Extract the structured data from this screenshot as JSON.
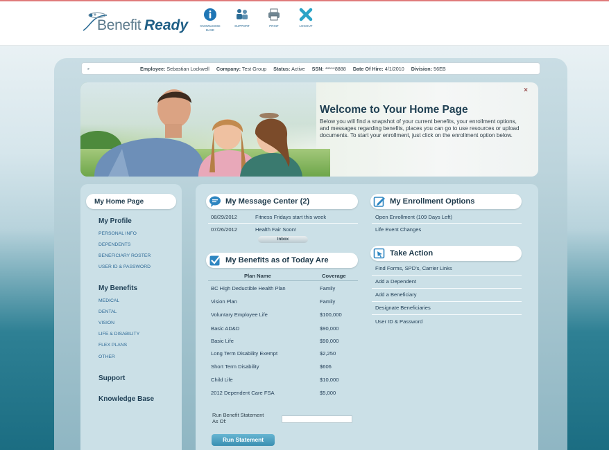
{
  "header": {
    "logo_text_1": "Benefit",
    "logo_text_2": "Ready",
    "nav": [
      {
        "label": "KNOWLEDGE BASE",
        "icon": "info-icon"
      },
      {
        "label": "SUPPORT",
        "icon": "people-icon"
      },
      {
        "label": "PRINT",
        "icon": "printer-icon"
      },
      {
        "label": "LOGOUT",
        "icon": "x-icon"
      }
    ]
  },
  "employee_bar": {
    "employee_label": "Employee:",
    "employee_value": "Sebastian Lockwell",
    "company_label": "Company:",
    "company_value": "Test Group",
    "status_label": "Status:",
    "status_value": "Active",
    "ssn_label": "SSN:",
    "ssn_value": "*****8888",
    "hire_label": "Date Of Hire:",
    "hire_value": "4/1/2010",
    "division_label": "Division:",
    "division_value": "56EB"
  },
  "welcome": {
    "close": "×",
    "title": "Welcome to Your Home Page",
    "body": "Below you will find a snapshot of your current benefits, your enrollment options, and messages regarding benefits, places you can go to use resources or upload documents. To start your enrollment, just click on the enrollment option below."
  },
  "sidebar": {
    "home": "My Home Page",
    "profile": {
      "title": "My Profile",
      "items": [
        "PERSONAL INFO",
        "DEPENDENTS",
        "BENEFICIARY ROSTER",
        "USER ID & PASSWORD"
      ]
    },
    "benefits": {
      "title": "My Benefits",
      "items": [
        "MEDICAL",
        "DENTAL",
        "VISION",
        "LIFE & DISABILITY",
        "FLEX PLANS",
        "OTHER"
      ]
    },
    "support": "Support",
    "knowledge": "Knowledge Base"
  },
  "message_center": {
    "title": "My Message Center (2)",
    "messages": [
      {
        "date": "08/29/2012",
        "subject": "Fitness Fridays start this week"
      },
      {
        "date": "07/26/2012",
        "subject": "Health Fair Soon!"
      }
    ],
    "inbox_label": "Inbox"
  },
  "benefits_today": {
    "title": "My Benefits as of Today Are",
    "col_plan": "Plan Name",
    "col_coverage": "Coverage",
    "rows": [
      {
        "plan": "BC High Deductible Health Plan",
        "coverage": "Family"
      },
      {
        "plan": "Vision Plan",
        "coverage": "Family"
      },
      {
        "plan": "Voluntary Employee Life",
        "coverage": "$100,000"
      },
      {
        "plan": "Basic AD&D",
        "coverage": "$90,000"
      },
      {
        "plan": "Basic Life",
        "coverage": "$90,000"
      },
      {
        "plan": "Long Term Disability Exempt",
        "coverage": "$2,250"
      },
      {
        "plan": "Short Term Disability",
        "coverage": "$606"
      },
      {
        "plan": "Child Life",
        "coverage": "$10,000"
      },
      {
        "plan": "2012 Dependent Care FSA",
        "coverage": "$5,000"
      }
    ],
    "statement_label": "Run Benefit Statement As Of:",
    "statement_value": "",
    "run_button": "Run Statement"
  },
  "enrollment": {
    "title": "My Enrollment Options",
    "items": [
      "Open Enrollment (109 Days Left)",
      "Life Event Changes"
    ]
  },
  "take_action": {
    "title": "Take Action",
    "items": [
      "Find Forms, SPD's, Carrier Links",
      "Add a Dependent",
      "Add a Beneficiary",
      "Designate Beneficiaries",
      "User ID & Password"
    ]
  }
}
